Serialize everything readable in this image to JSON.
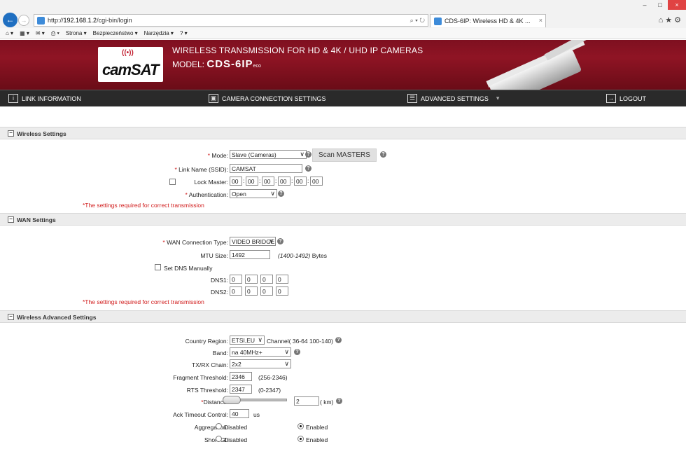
{
  "browser": {
    "url_prefix": "http://",
    "url_host": "192.168.1.2",
    "url_path": "/cgi-bin/login",
    "address_tools": "⌕ ▾ ↻",
    "tab_title": "CDS-6IP: Wireless HD & 4K ...",
    "tab_close": "×",
    "back": "←",
    "forward": "→",
    "minimize": "–",
    "maximize": "□",
    "close": "×",
    "right_icons": "⌂★⚙",
    "command_bar": [
      "⌂ ▾",
      "▦ ▾",
      "✉ ▾",
      "⎙ ▾",
      "Strona ▾",
      "Bezpieczeństwo ▾",
      "Narzędzia ▾",
      "? ▾"
    ]
  },
  "header": {
    "logo_waves": "((•))",
    "logo_text": "camSAT",
    "title": "WIRELESS TRANSMISSION FOR HD & 4K / UHD IP CAMERAS",
    "model_label": "MODEL:",
    "model_value": "CDS-6IP",
    "model_suffix": "eco"
  },
  "nav": {
    "link_info": "LINK INFORMATION",
    "camera": "CAMERA CONNECTION SETTINGS",
    "advanced": "ADVANCED SETTINGS",
    "advanced_arrow": "▾",
    "logout": "LOGOUT",
    "ico_info": "i",
    "ico_cam": "▣",
    "ico_adv": "☰",
    "ico_logout": "→"
  },
  "wireless": {
    "title": "Wireless Settings",
    "toggle": "−",
    "mode_label": "Mode:",
    "mode_value": "Slave (Cameras)",
    "scan_button": "Scan MASTERS",
    "ssid_label": "Link Name (SSID):",
    "ssid_value": "CAMSAT",
    "lock_label": "Lock Master:",
    "mac": [
      "00",
      "00",
      "00",
      "00",
      "00",
      "00"
    ],
    "auth_label": "Authentication:",
    "auth_value": "Open",
    "note": "*The settings required for correct transmission"
  },
  "wan": {
    "title": "WAN Settings",
    "toggle": "−",
    "conn_label": "WAN Connection Type:",
    "conn_value": "VIDEO BRIDGE",
    "mtu_label": "MTU Size:",
    "mtu_value": "1492",
    "mtu_range": "(1400-1492)",
    "mtu_unit": "Bytes",
    "dns_manual_label": "Set DNS Manually",
    "dns1_label": "DNS1:",
    "dns1": [
      "0",
      "0",
      "0",
      "0"
    ],
    "dns2_label": "DNS2:",
    "dns2": [
      "0",
      "0",
      "0",
      "0"
    ],
    "note": "*The settings required for correct transmission"
  },
  "advanced": {
    "title": "Wireless Advanced Settings",
    "toggle": "−",
    "country_label": "Country Region:",
    "country_value": "ETSI,EU",
    "channel_text": "Channel( 36-64 100-140)",
    "band_label": "Band:",
    "band_value": "na 40MHz+",
    "txrx_label": "TX/RX Chain:",
    "txrx_value": "2x2",
    "frag_label": "Fragment Threshold:",
    "frag_value": "2346",
    "frag_range": "(256-2346)",
    "rts_label": "RTS Threshold:",
    "rts_value": "2347",
    "rts_range": "(0-2347)",
    "distance_label": "Distance:",
    "distance_value": "2",
    "distance_unit": "( km)",
    "ack_label": "Ack Timeout Control:",
    "ack_value": "40",
    "ack_unit": "us",
    "aggregation_label": "Aggregation:",
    "short_gi_label": "Short GI:",
    "disabled": "Disabled",
    "enabled": "Enabled"
  },
  "help_glyph": "?",
  "chevron": "∨",
  "req_mark": "*"
}
